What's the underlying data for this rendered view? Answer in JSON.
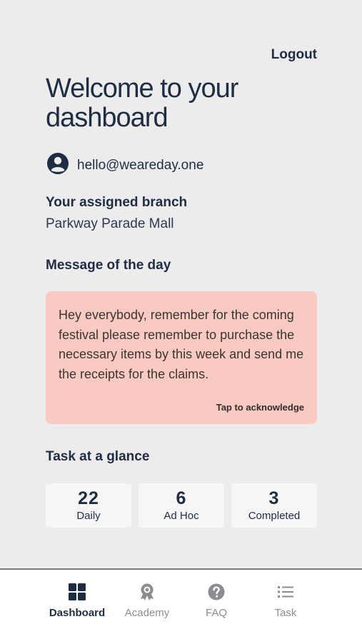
{
  "header": {
    "logout_label": "Logout"
  },
  "page_title": "Welcome to your dashboard",
  "user": {
    "email": "hello@weareday.one"
  },
  "branch": {
    "label": "Your assigned branch",
    "name": "Parkway Parade Mall"
  },
  "message": {
    "heading": "Message of the day",
    "text": "Hey everybody, remember for the coming festival please remember to purchase the necessary items by this week and send me the receipts for the claims.",
    "acknowledge_label": "Tap to acknowledge",
    "background_color": "#f9cac2"
  },
  "tasks": {
    "heading": "Task at a glance",
    "stats": [
      {
        "value": "22",
        "label": "Daily"
      },
      {
        "value": "6",
        "label": "Ad Hoc"
      },
      {
        "value": "3",
        "label": "Completed"
      }
    ]
  },
  "nav": {
    "items": [
      {
        "label": "Dashboard",
        "icon": "grid-icon",
        "active": true
      },
      {
        "label": "Academy",
        "icon": "award-icon",
        "active": false
      },
      {
        "label": "FAQ",
        "icon": "question-icon",
        "active": false
      },
      {
        "label": "Task",
        "icon": "list-icon",
        "active": false
      }
    ]
  },
  "colors": {
    "primary": "#1f2d44",
    "background": "#ececec",
    "inactive": "#8b8d92"
  }
}
